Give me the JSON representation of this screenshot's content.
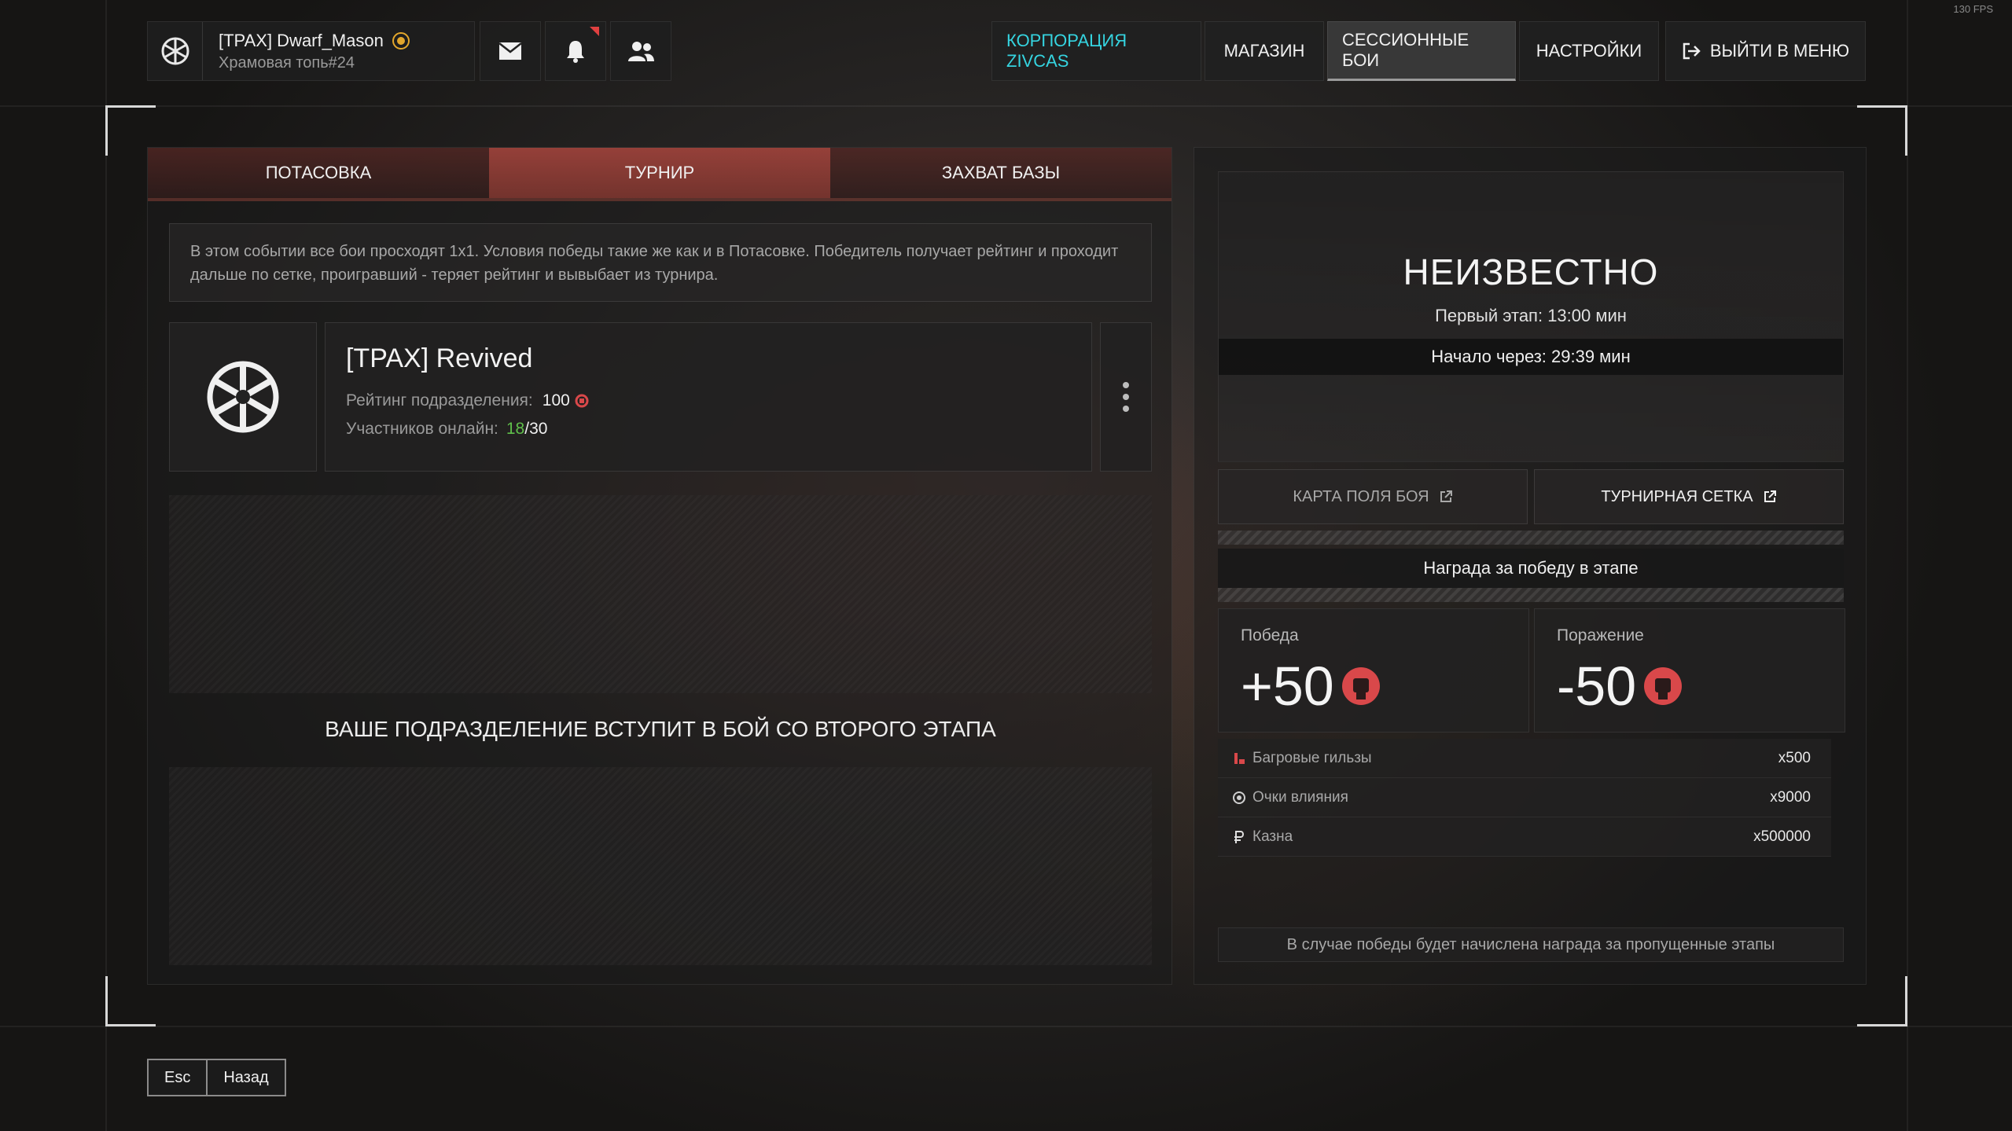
{
  "fps": "130 FPS",
  "profile": {
    "nickname": "[TPAX] Dwarf_Mason",
    "subtitle": "Храмовая топь#24"
  },
  "nav": {
    "corporation": "КОРПОРАЦИЯ ZIVCAS",
    "shop": "МАГАЗИН",
    "session_battles": "СЕССИОННЫЕ БОИ",
    "settings": "НАСТРОЙКИ",
    "exit": "ВЫЙТИ В МЕНЮ"
  },
  "tabs": [
    "ПОТАСОВКА",
    "ТУРНИР",
    "ЗАХВАТ БАЗЫ"
  ],
  "active_tab": "ТУРНИР",
  "description": "В этом событии все бои просходят 1x1. Условия победы такие же как и в Потасовке. Победитель получает рейтинг и проходит дальше по сетке, проигравший - теряет рейтинг и вывыбает из турнира.",
  "unit": {
    "name": "[TPAX] Revived",
    "rating_label": "Рейтинг подразделения:",
    "rating_value": "100",
    "online_label": "Участников онлайн:",
    "online_current": "18",
    "online_separator": "/",
    "online_max": "30"
  },
  "stage_message": "ВАШЕ ПОДРАЗДЕЛЕНИЕ ВСТУПИТ В БОЙ СО ВТОРОГО ЭТАПА",
  "tournament": {
    "status": "НЕИЗВЕСТНО",
    "first_stage": "Первый этап: 13:00 мин",
    "starts_in": "Начало через: 29:39 мин",
    "map_button": "КАРТА ПОЛЯ БОЯ",
    "bracket_button": "ТУРНИРНАЯ СЕТКА",
    "reward_header": "Награда за победу в этапе",
    "win_label": "Победа",
    "win_value": "+50",
    "loss_label": "Поражение",
    "loss_value": "-50",
    "rewards": [
      {
        "name": "Багровые гильзы",
        "qty": "x500",
        "icon": "crimson-shells-icon"
      },
      {
        "name": "Очки влияния",
        "qty": "x9000",
        "icon": "influence-points-icon"
      },
      {
        "name": "Казна",
        "qty": "x500000",
        "icon": "treasury-icon"
      }
    ],
    "footer_note": "В случае победы будет начислена награда за пропущенные этапы"
  },
  "keys": {
    "esc": "Esc",
    "back": "Назад"
  },
  "colors": {
    "accent_cyan": "#35d4e0",
    "tab_active": "#aa463e",
    "online_green": "#5fbf4a",
    "rating_red": "#d9484a"
  }
}
